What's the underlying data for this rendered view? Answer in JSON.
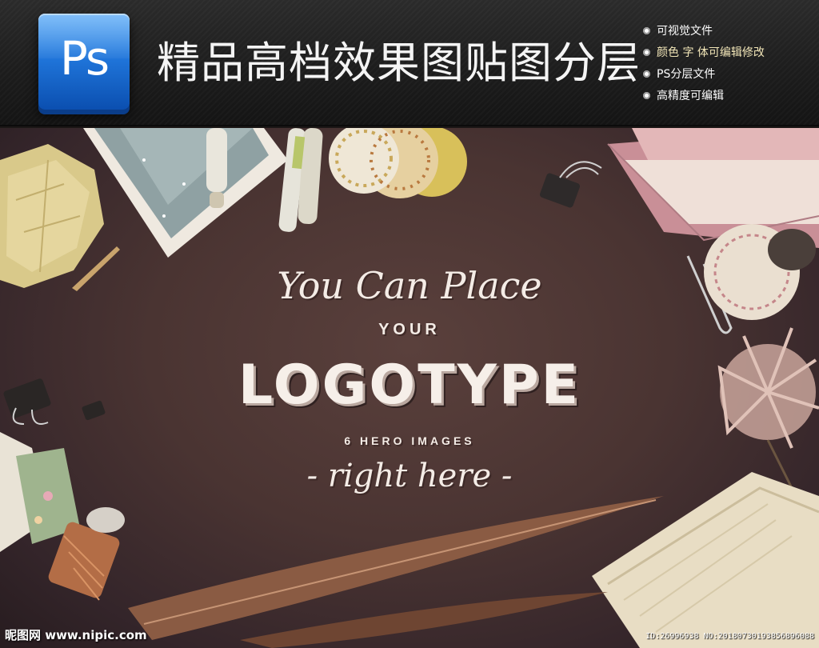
{
  "header": {
    "logo_text": "Ps",
    "title": "精品高档效果图贴图分层",
    "features": [
      {
        "label": "可视觉文件",
        "color": "#ffffff"
      },
      {
        "label": "颜色 字 体可编辑修改",
        "color": "#f2e6b8"
      },
      {
        "label": "PS分层文件",
        "color": "#ffffff"
      },
      {
        "label": "高精度可编辑",
        "color": "#ffffff"
      }
    ]
  },
  "mockup": {
    "line1": "You Can Place",
    "line2": "YOUR",
    "line3": "LOGOTYPE",
    "line4": "6 HERO IMAGES",
    "line5": "- right here -"
  },
  "watermark": {
    "site": "昵图网 www.nipic.com",
    "id": "ID:26996938 NO:20180730193856896088"
  },
  "colors": {
    "logo_blue": "#1f74d9",
    "background": "#4a3432",
    "text_cream": "#f4ece6",
    "accent_text": "#f2e6b8"
  }
}
